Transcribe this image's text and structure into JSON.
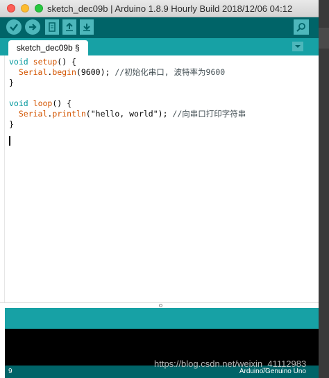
{
  "window": {
    "title": "sketch_dec09b | Arduino 1.8.9 Hourly Build 2018/12/06 04:12"
  },
  "toolbar": {
    "verify": "verify-icon",
    "upload": "upload-icon",
    "new": "new-file-icon",
    "open": "open-file-icon",
    "save": "save-file-icon",
    "serial_monitor": "serial-monitor-icon"
  },
  "tab": {
    "label": "sketch_dec09b §"
  },
  "code": {
    "l1_kw": "void",
    "l1_fn": "setup",
    "l1_rest": "() {",
    "l2_obj": "  Serial",
    "l2_dot": ".",
    "l2_fn": "begin",
    "l2_args": "(9600); ",
    "l2_comment": "//初始化串口, 波特率为9600",
    "l3": "}",
    "l5_kw": "void",
    "l5_fn": "loop",
    "l5_rest": "() {",
    "l6_obj": "  Serial",
    "l6_dot": ".",
    "l6_fn": "println",
    "l6_args": "(\"hello, world\"); ",
    "l6_comment": "//向串口打印字符串",
    "l7": "}"
  },
  "footer": {
    "line_number": "9",
    "board": "Arduino/Genuino Uno"
  },
  "watermark": "https://blog.csdn.net/weixin_41112983",
  "colors": {
    "toolbar_bg": "#006468",
    "tabbar_bg": "#17a1a5",
    "button_bg": "#4db7bb",
    "keyword": "#00979c",
    "function": "#d35400"
  }
}
